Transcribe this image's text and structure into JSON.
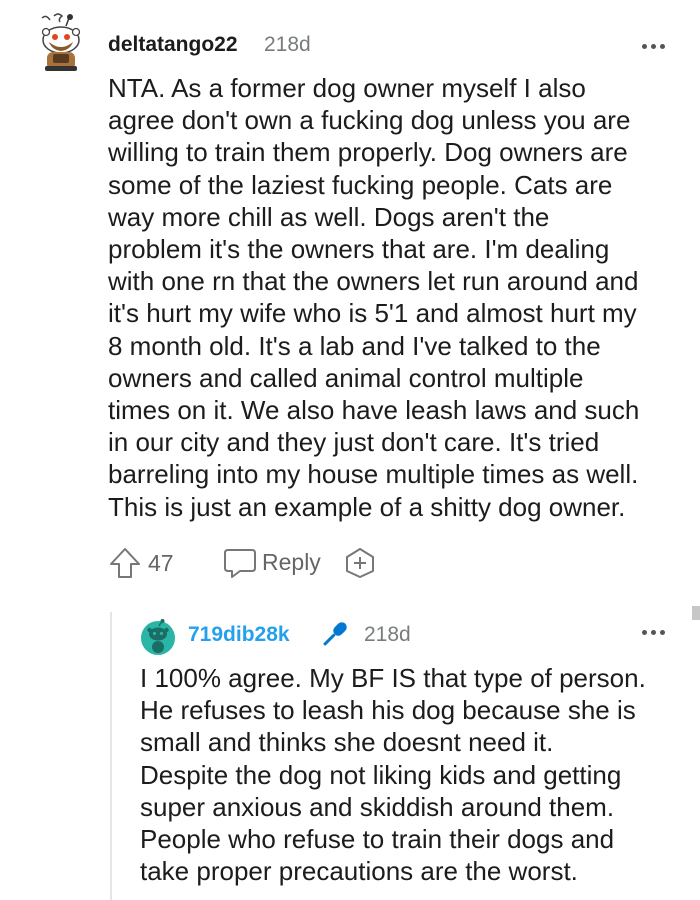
{
  "comments": [
    {
      "username": "deltatango22",
      "age": "218d",
      "avatar_icon": "snoo-avatar-icon",
      "lines": [
        "NTA. As a former dog owner myself I also",
        "agree don't own a fucking dog unless you are",
        "willing to train them properly. Dog owners are",
        "some of the laziest fucking people. Cats are",
        "way more chill as well. Dogs aren't the",
        "problem it's the owners that are. I'm dealing",
        "with one rn that the owners let run around and",
        "it's hurt my wife who is 5'1 and almost hurt my",
        "8 month old. It's a lab and I've talked to the",
        "owners and called animal control multiple",
        "times on it. We also have leash laws and such",
        "in our city and they just don't care. It's tried",
        "barreling into my house multiple times as well.",
        "This is just an example of a shitty dog owner."
      ],
      "votes": "47",
      "reply_label": "Reply"
    },
    {
      "username": "719dib28k",
      "age": "218d",
      "avatar_icon": "snoo-avatar-icon",
      "badge_icon": "microphone-icon",
      "username_color": "#24a0ed",
      "lines": [
        "I 100% agree. My BF IS that type of person.",
        "He refuses to leash his dog because she is",
        "small and thinks she doesnt need it.",
        "Despite the dog not liking kids and getting",
        "super anxious and skiddish around them.",
        "People who refuse to train their dogs and",
        "take proper precautions are the worst."
      ]
    }
  ]
}
